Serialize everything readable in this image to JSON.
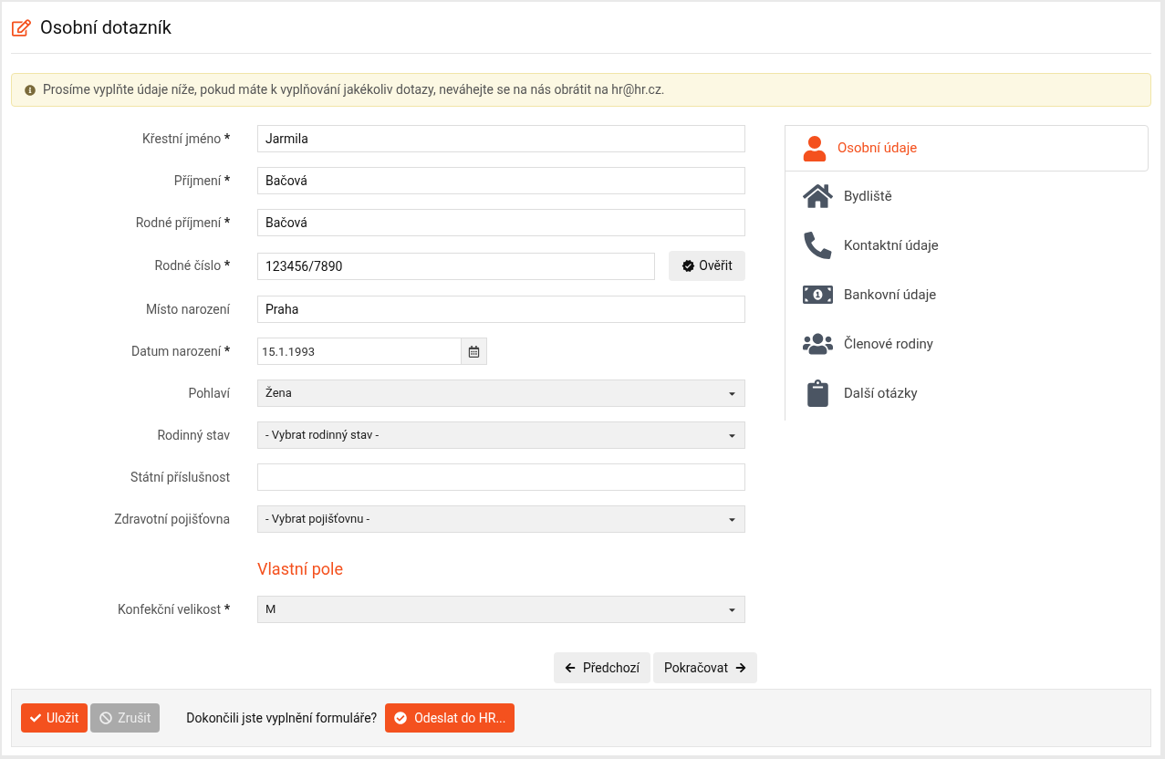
{
  "title": "Osobní dotazník",
  "alert": "Prosíme vyplňte údaje níže, pokud máte k vyplňování jakékoliv dotazy, neváhejte se na nás obrátit na hr@hr.cz.",
  "form": [
    {
      "kind": "text",
      "label": "Křestní jméno",
      "mark": "*",
      "value": "Jarmila"
    },
    {
      "kind": "text",
      "label": "Příjmení",
      "mark": "*",
      "value": "Bačová"
    },
    {
      "kind": "text",
      "label": "Rodné příjmení",
      "mark": "*",
      "value": "Bačová"
    },
    {
      "kind": "verify",
      "label": "Rodné číslo",
      "mark": "*",
      "value": "123456/7890",
      "button": "Ověřit"
    },
    {
      "kind": "text",
      "label": "Místo narození",
      "value": "Praha"
    },
    {
      "kind": "date",
      "label": "Datum narození",
      "mark": "*",
      "value": "15.1.1993"
    },
    {
      "kind": "select",
      "label": "Pohlaví",
      "value": "Žena"
    },
    {
      "kind": "select",
      "label": "Rodinný stav",
      "value": "- Vybrat rodinný stav -"
    },
    {
      "kind": "text",
      "label": "Státní příslušnost"
    },
    {
      "kind": "select",
      "label": "Zdravotní pojišťovna",
      "value": "- Vybrat pojišťovnu -"
    },
    {
      "kind": "heading",
      "label": "Vlastní pole"
    },
    {
      "kind": "select",
      "label": "Konfekční velikost",
      "mark": "*",
      "value": "M"
    }
  ],
  "nav": {
    "previous": "Předchozí",
    "next": "Pokračovat"
  },
  "sidebar": [
    {
      "label": "Osobní údaje",
      "selected": true
    },
    {
      "label": "Bydliště",
      "selected": false
    },
    {
      "label": "Kontaktní údaje",
      "selected": false
    },
    {
      "label": "Bankovní údaje",
      "selected": false
    },
    {
      "label": "Členové rodiny",
      "selected": false
    },
    {
      "label": "Další otázky",
      "selected": false
    }
  ],
  "footer": {
    "save": {
      "label": "Uložit",
      "disabled": false
    },
    "cancel": {
      "label": "Zrušit",
      "disabled": true
    },
    "question": "Dokončili jste vyplnění formuláře?",
    "submit": "Odeslat do HR..."
  }
}
